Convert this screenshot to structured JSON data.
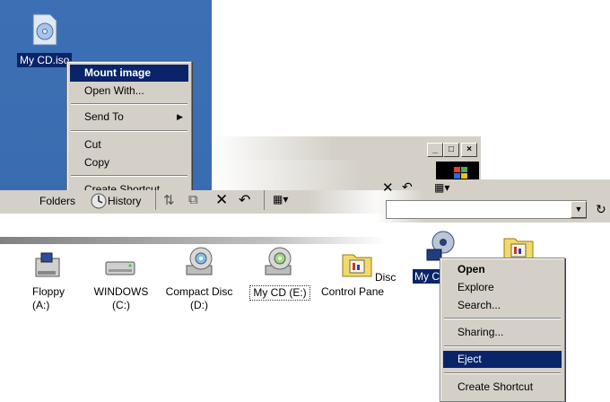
{
  "desktop": {
    "file_label": "My CD.iso",
    "icon": "cd-image-file-icon"
  },
  "desktop_menu": {
    "items": [
      "Mount image",
      "Open With...",
      "Send To",
      "Cut",
      "Copy",
      "Create Shortcut"
    ]
  },
  "window": {
    "controls": {
      "minimize": "_",
      "maximize": "□",
      "close": "×"
    }
  },
  "toolbar": {
    "folders": "Folders",
    "history": "History"
  },
  "drives": {
    "items": [
      {
        "label_line1": "Floppy",
        "label_line2": "(A:)",
        "icon": "floppy-drive-icon"
      },
      {
        "label_line1": "WINDOWS",
        "label_line2": "(C:)",
        "icon": "hard-drive-icon"
      },
      {
        "label_line1": "Compact Disc",
        "label_line2": "(D:)",
        "icon": "cd-drive-icon"
      },
      {
        "label_line1": "My CD (E:)",
        "label_line2": "",
        "icon": "cd-drive-icon"
      },
      {
        "label_line1": "Control Pane",
        "label_line2": "",
        "icon": "control-panel-icon"
      }
    ],
    "partial_label": "Disc",
    "right_label": "My C",
    "right_icons": [
      "network-drive-icon",
      "control-panel-icon"
    ]
  },
  "drive_menu": {
    "items": [
      "Open",
      "Explore",
      "Search...",
      "Sharing...",
      "Eject",
      "Create Shortcut"
    ]
  },
  "colors": {
    "desktop": "#3a6cb0",
    "selection": "#0a246a",
    "face": "#d4d0c8"
  }
}
